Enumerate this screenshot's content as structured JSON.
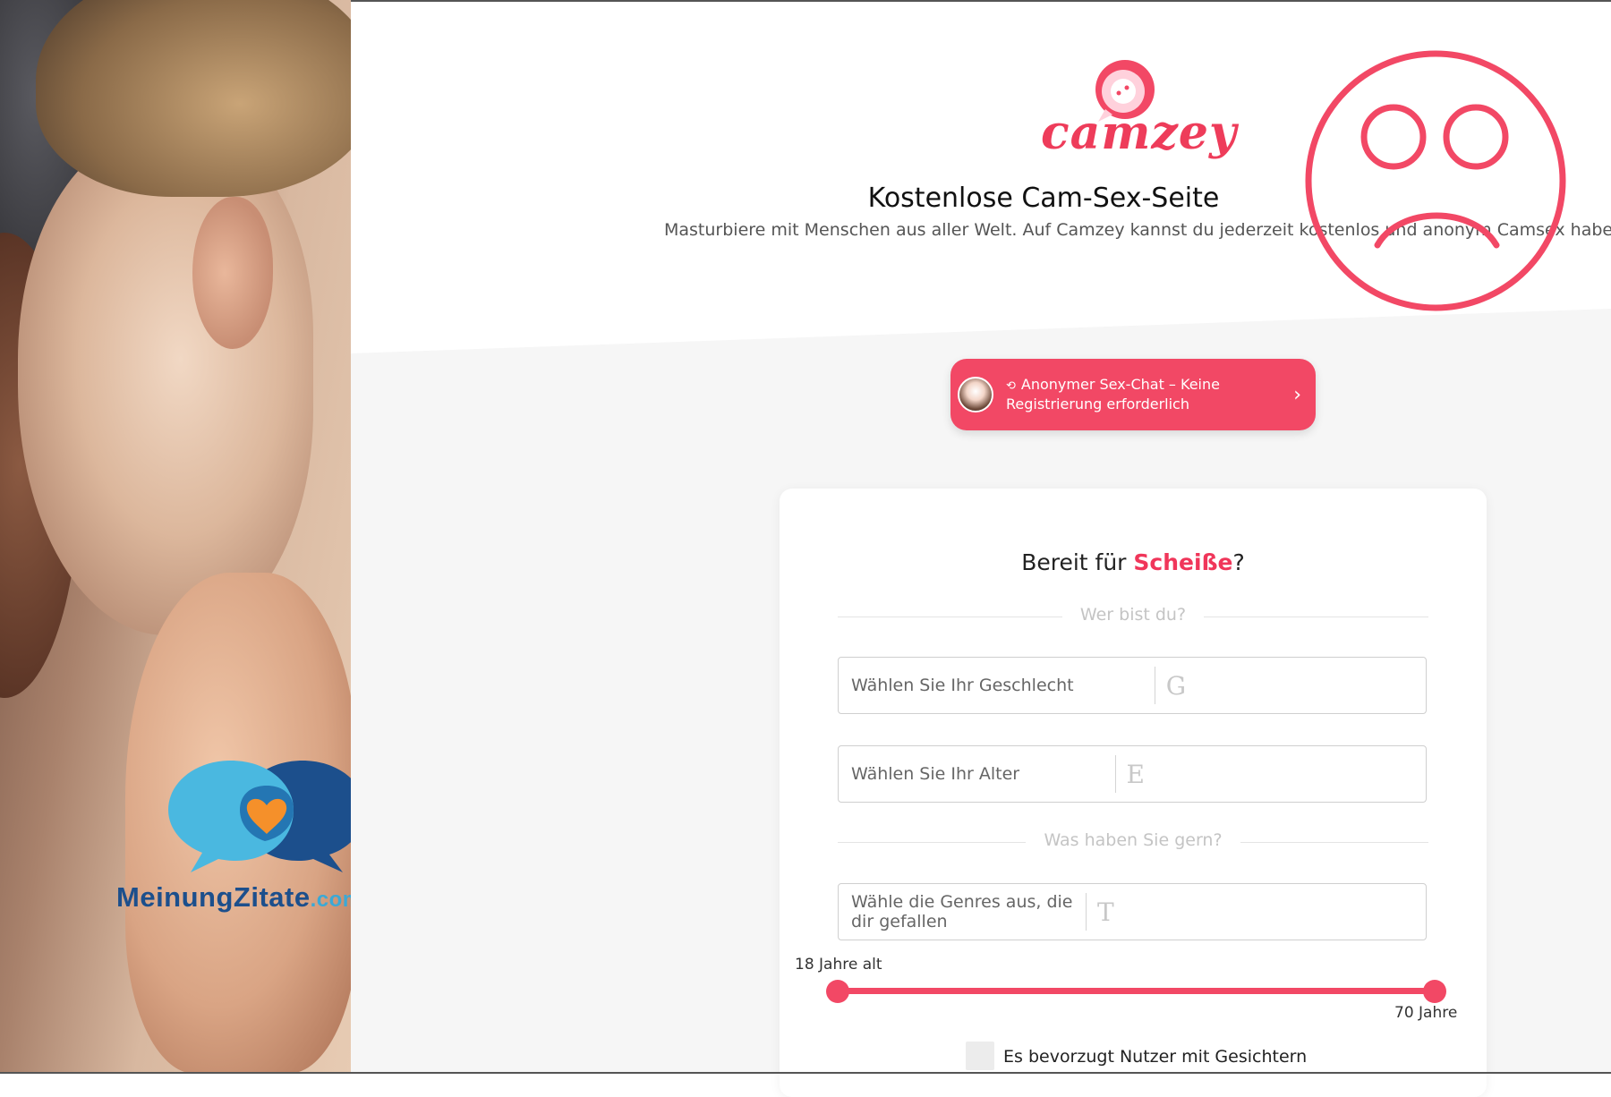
{
  "brand": {
    "logo_text": "camzey",
    "accent_color": "#f24865"
  },
  "header": {
    "headline": "Kostenlose Cam-Sex-Seite",
    "subtitle": "Masturbiere mit Menschen aus aller Welt. Auf Camzey kannst du jederzeit kostenlos und anonym Camsex haben."
  },
  "cta": {
    "label": "Anonymer Sex-Chat – Keine Registrierung erforderlich",
    "icon": "refresh-icon",
    "chevron": "›"
  },
  "form": {
    "title_prefix": "Bereit für ",
    "title_highlight": "Scheiße",
    "title_suffix": "?",
    "section1_label": "Wer bist du?",
    "gender_placeholder": "Wählen Sie Ihr Geschlecht",
    "gender_letter": "G",
    "age_placeholder": "Wählen Sie Ihr Alter",
    "age_letter": "E",
    "section2_label": "Was haben Sie gern?",
    "genres_placeholder": "Wähle die Genres aus, die dir gefallen",
    "genres_letter": "T",
    "age_range_min_label": "18 Jahre alt",
    "age_range_max_label": "70 Jahre",
    "age_range": {
      "min": 18,
      "max": 70
    },
    "faces_checkbox_label": "Es bevorzugt Nutzer mit Gesichtern",
    "faces_checked": false
  },
  "overlay": {
    "sad_face_icon": "sad-face-icon",
    "sad_face_color": "#f24865"
  },
  "watermark": {
    "name": "MeinungZitate",
    "domain": ".com",
    "icon": "chat-heart-icon"
  }
}
